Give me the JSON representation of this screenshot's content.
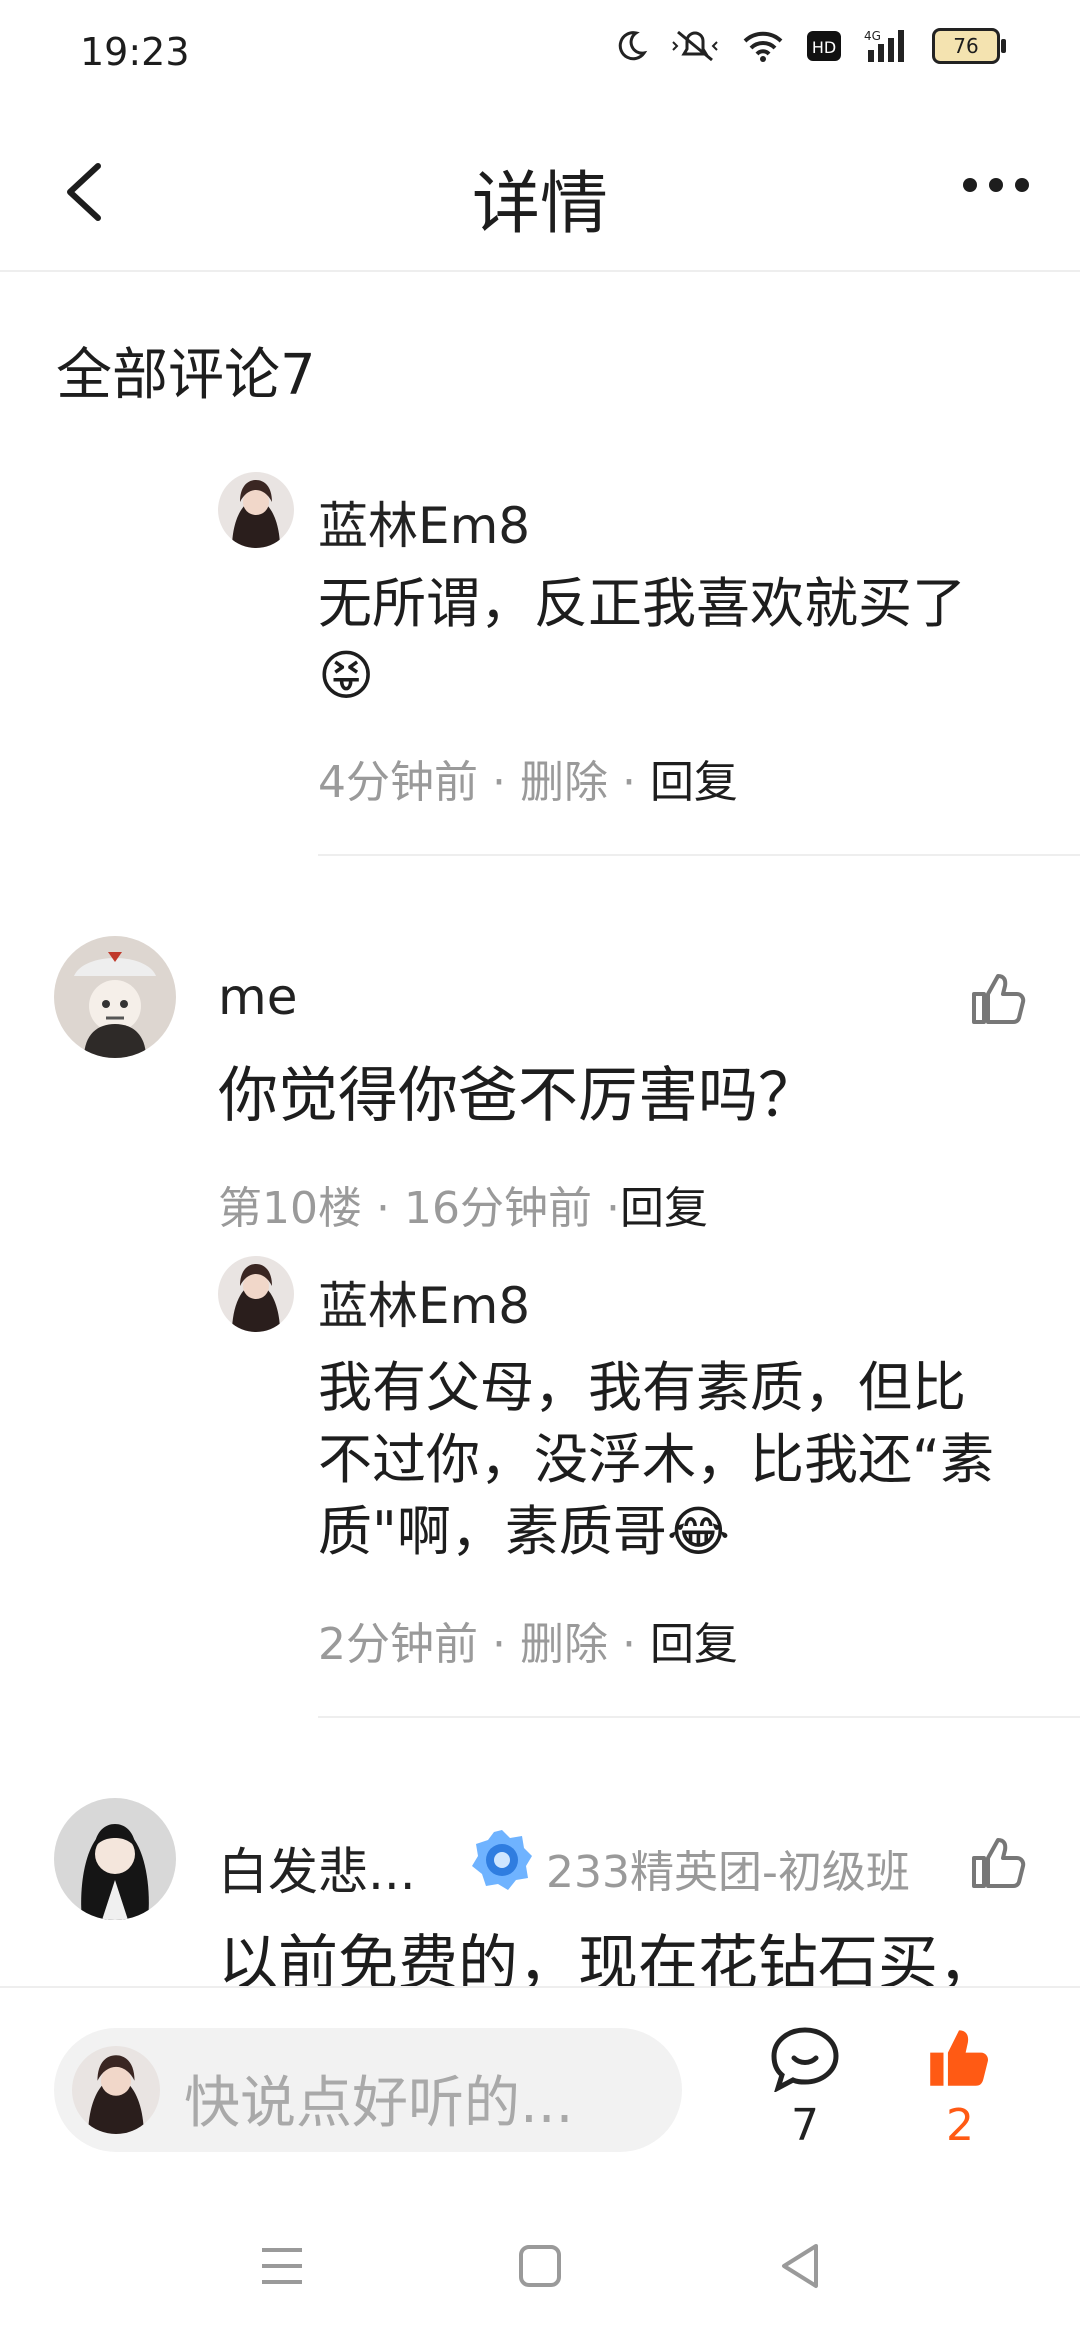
{
  "status": {
    "time": "19:23",
    "battery": "76"
  },
  "header": {
    "title": "详情"
  },
  "section": {
    "title": "全部评论7"
  },
  "comments": [
    {
      "type": "reply",
      "user": "蓝林Em8",
      "text_line1": "无所谓，反正我喜欢就买了",
      "emoji": "😝",
      "time": "4分钟前",
      "delete": "删除",
      "reply": "回复"
    },
    {
      "type": "top",
      "user": "me",
      "text": "你觉得你爸不厉害吗？",
      "floor": "第10楼",
      "time": "16分钟前",
      "reply": "回复",
      "sub_reply": {
        "user": "蓝林Em8",
        "line1": "我有父母，我有素质，但比",
        "line2": "不过你，没浮木，比我还“素",
        "line3": "质\"啊，素质哥",
        "emoji": "😂",
        "time": "2分钟前",
        "delete": "删除",
        "reply": "回复"
      }
    },
    {
      "type": "top",
      "user": "白发悲...",
      "badge": "233精英团-初级班",
      "text": "以前免费的，现在花钻石买，"
    }
  ],
  "bottom": {
    "placeholder": "快说点好听的...",
    "comment_count": "7",
    "like_count": "2",
    "like_color": "#ff5a14"
  }
}
